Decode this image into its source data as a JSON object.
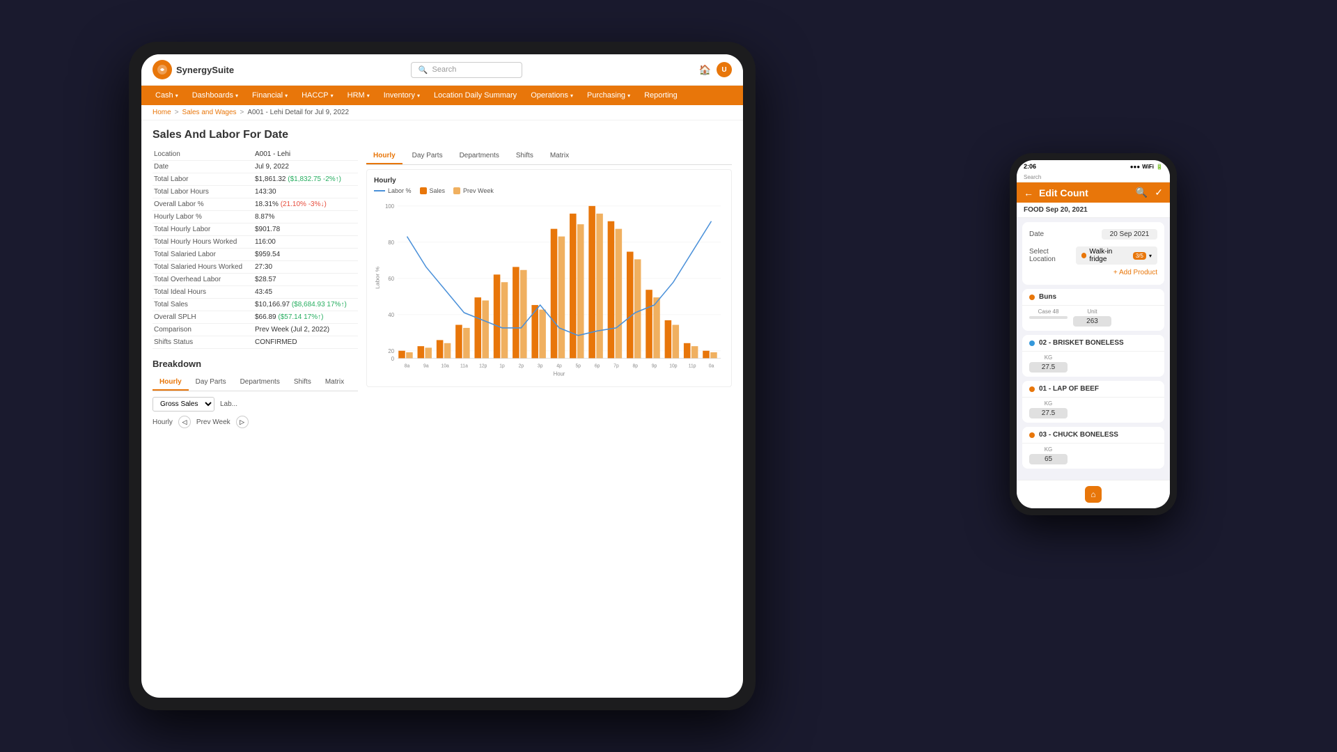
{
  "background": "#1a1a2e",
  "tablet": {
    "topbar": {
      "logo_text": "SynergySuite",
      "search_placeholder": "Search"
    },
    "nav": {
      "items": [
        {
          "label": "Cash",
          "has_caret": true
        },
        {
          "label": "Dashboards",
          "has_caret": true
        },
        {
          "label": "Financial",
          "has_caret": true
        },
        {
          "label": "HACCP",
          "has_caret": true
        },
        {
          "label": "HRM",
          "has_caret": true
        },
        {
          "label": "Inventory",
          "has_caret": true
        },
        {
          "label": "Location Daily Summary",
          "has_caret": false
        },
        {
          "label": "Operations",
          "has_caret": true
        },
        {
          "label": "Purchasing",
          "has_caret": true
        },
        {
          "label": "Reporting",
          "has_caret": false
        }
      ]
    },
    "breadcrumb": {
      "home": "Home",
      "sep1": ">",
      "link1": "Sales and Wages",
      "sep2": ">",
      "current": "A001 - Lehi Detail for Jul 9, 2022"
    },
    "page_title": "Sales And Labor For Date",
    "info": {
      "rows": [
        {
          "label": "Location",
          "value": "A001 - Lehi"
        },
        {
          "label": "Date",
          "value": "Jul 9, 2022"
        },
        {
          "label": "Total Labor",
          "value": "$1,861.32",
          "extra": "($1,832.75 -2%↑)",
          "extra_class": "val-green"
        },
        {
          "label": "Total Labor Hours",
          "value": "143:30"
        },
        {
          "label": "Overall Labor %",
          "value": "18.31%",
          "extra": "(21.10% -3%↓)",
          "extra_class": "val-red"
        },
        {
          "label": "Hourly Labor %",
          "value": "8.87%"
        },
        {
          "label": "Total Hourly Labor",
          "value": "$901.78"
        },
        {
          "label": "Total Hourly Hours Worked",
          "value": "116:00"
        },
        {
          "label": "Total Salaried Labor",
          "value": "$959.54"
        },
        {
          "label": "Total Salaried Hours Worked",
          "value": "27:30"
        },
        {
          "label": "Total Overhead Labor",
          "value": "$28.57"
        },
        {
          "label": "Total Ideal Hours",
          "value": "43:45"
        },
        {
          "label": "Total Sales",
          "value": "$10,166.97",
          "extra": "($8,684.93 17%↑)",
          "extra_class": "val-green"
        },
        {
          "label": "Overall SPLH",
          "value": "$66.89",
          "extra": "($57.14 17%↑)",
          "extra_class": "val-green"
        },
        {
          "label": "Comparison",
          "value": "Prev Week (Jul 2, 2022)"
        },
        {
          "label": "Shifts Status",
          "value": "CONFIRMED"
        }
      ]
    },
    "breakdown": {
      "title": "Breakdown",
      "tabs": [
        "Hourly",
        "Day Parts",
        "Departments",
        "Shifts",
        "Matrix"
      ],
      "active_tab": "Hourly",
      "dropdown_label": "Gross Sales",
      "hourly_label": "Hourly",
      "prev_week_label": "Prev Week"
    },
    "chart": {
      "tabs": [
        "Hourly",
        "Day Parts",
        "Departments",
        "Shifts",
        "Matrix"
      ],
      "active_tab": "Hourly",
      "title": "Hourly",
      "legend": [
        {
          "label": "Labor %",
          "type": "line",
          "color": "#4a90d9"
        },
        {
          "label": "Sales",
          "type": "bar",
          "color": "#e8760a"
        },
        {
          "label": "Prev Week",
          "type": "bar",
          "color": "#f0b060"
        }
      ],
      "x_label": "Hour",
      "y_label": "Labor %",
      "hours": [
        "8a",
        "9a",
        "10a",
        "11a",
        "12p",
        "1p",
        "2p",
        "3p",
        "4p",
        "5p",
        "6p",
        "7p",
        "8p",
        "9p",
        "10p",
        "11p",
        "0a"
      ],
      "sales_bars": [
        5,
        8,
        12,
        22,
        40,
        55,
        60,
        35,
        85,
        95,
        100,
        90,
        70,
        45,
        25,
        10,
        5
      ],
      "prev_bars": [
        4,
        7,
        10,
        20,
        38,
        50,
        58,
        32,
        80,
        88,
        95,
        85,
        65,
        40,
        22,
        8,
        4
      ],
      "labor_line": [
        80,
        60,
        45,
        30,
        25,
        20,
        20,
        35,
        20,
        15,
        18,
        20,
        30,
        35,
        50,
        70,
        90
      ]
    }
  },
  "phone": {
    "status_bar": {
      "time": "2:06",
      "signal": "▲▼",
      "wifi": "WiFi",
      "battery": "■"
    },
    "header": {
      "back_icon": "←",
      "title": "Edit Count",
      "search_icon": "🔍",
      "check_icon": "✓"
    },
    "sub_header": {
      "label": "FOOD Sep 20, 2021"
    },
    "date_field": {
      "label": "Date",
      "value": "20 Sep 2021"
    },
    "location_field": {
      "label": "Select Location",
      "value": "Walk-in fridge",
      "badge": "3/5"
    },
    "add_product": "+ Add Product",
    "products": [
      {
        "name": "Buns",
        "dot_color": "orange",
        "inputs": [
          {
            "label": "Case 48",
            "value": ""
          },
          {
            "label": "Unit",
            "value": "263"
          }
        ]
      },
      {
        "name": "02 - BRISKET BONELESS",
        "dot_color": "blue",
        "inputs": [
          {
            "label": "KG",
            "value": "27.5"
          }
        ]
      },
      {
        "name": "01 - LAP OF BEEF",
        "dot_color": "orange",
        "inputs": [
          {
            "label": "KG",
            "value": "27.5"
          }
        ]
      },
      {
        "name": "03 - CHUCK BONELESS",
        "dot_color": "orange",
        "inputs": [
          {
            "label": "KG",
            "value": "65"
          }
        ]
      }
    ],
    "bottom_bar": {
      "home_icon": "⌂"
    }
  }
}
